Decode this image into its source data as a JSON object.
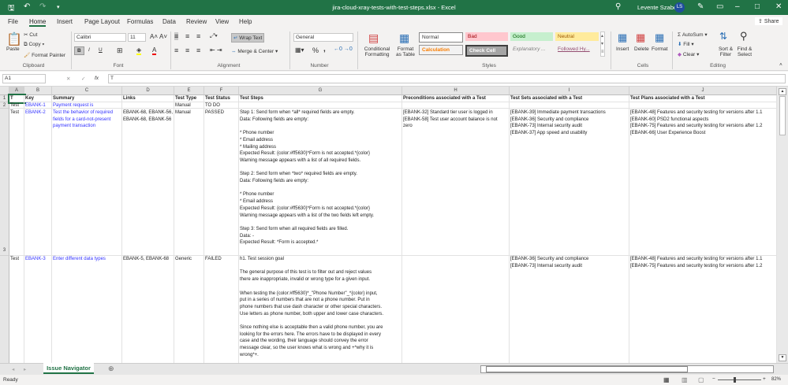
{
  "title": "jira-cloud-xray-tests-with-test-steps.xlsx - Excel",
  "user": {
    "name": "Levente Szabo",
    "initials": "LS"
  },
  "share": "Share",
  "tabs": [
    "File",
    "Home",
    "Insert",
    "Page Layout",
    "Formulas",
    "Data",
    "Review",
    "View",
    "Help"
  ],
  "ribbon": {
    "clipboard": {
      "paste": "Paste",
      "cut": "Cut",
      "copy": "Copy",
      "format_painter": "Format Painter",
      "label": "Clipboard"
    },
    "font": {
      "name": "Calibri",
      "size": "11",
      "bold": "B",
      "italic": "I",
      "underline": "U",
      "label": "Font"
    },
    "alignment": {
      "wrap": "Wrap Text",
      "merge": "Merge & Center",
      "label": "Alignment"
    },
    "number": {
      "format": "General",
      "percent": "%",
      "comma": ",",
      "label": "Number"
    },
    "styles": {
      "conditional": "Conditional Formatting",
      "format_table": "Format as Table",
      "normal": "Normal",
      "bad": "Bad",
      "good": "Good",
      "neutral": "Neutral",
      "calculation": "Calculation",
      "check": "Check Cell",
      "explanatory": "Explanatory ...",
      "followed": "Followed Hy...",
      "label": "Styles"
    },
    "cells": {
      "insert": "Insert",
      "delete": "Delete",
      "format": "Format",
      "label": "Cells"
    },
    "editing": {
      "autosum": "AutoSum",
      "fill": "Fill",
      "clear": "Clear",
      "sort": "Sort & Filter",
      "find": "Find & Select",
      "label": "Editing"
    }
  },
  "formula_bar": {
    "name_box": "A1",
    "cancel": "✕",
    "enter": "✓",
    "fx": "fx",
    "value": "T"
  },
  "columns": [
    "A",
    "B",
    "C",
    "D",
    "E",
    "F",
    "G",
    "H",
    "I",
    "J"
  ],
  "row_numbers": [
    "1",
    "2",
    "3"
  ],
  "headers": [
    "T",
    "Key",
    "Summary",
    "Links",
    "Test Type",
    "Test Status",
    "Test Steps",
    "Preconditions associated with a Test",
    "Test Sets associated with a Test",
    "Test Plans associated with a Test"
  ],
  "rows": [
    [
      "Test",
      "EBANK-1",
      "Payment request is",
      "",
      "Manual",
      "TO DO",
      "",
      "",
      "",
      ""
    ],
    [
      "Test",
      "EBANK-2",
      "Test the behavior of required\nfields for a card-not-present\npayment transaction",
      "EBANK-68, EBANK-56,\nEBANK-68, EBANK-56",
      "Manual",
      "PASSED",
      "Step 1: Send form when *all* required fields are empty.\nData: Following fields are empty:\n\n* Phone number\n* Email address\n* Mailing address\nExpected Result: {color:#ff5630}*Form is not accepted.*{color}\nWarning message appears with a list of all required fields.\n\nStep 2: Send form when *two* required fields are empty.\nData: Following fields are empty:\n\n* Phone number\n* Email address\nExpected Result: {color:#ff5630}*Form is not accepted.*{color}\nWarning message appears with a list of the two fields left empty.\n\nStep 3: Send form when all required fields are filled.\nData: -\nExpected Result: *Form is accepted.*",
      "[EBANK-32] Standard tier user is logged in\n[EBANK-58] Test user account balance is not\nzero",
      "[EBANK-39] Immediate payment transactions\n[EBANK-36] Security and compliance\n[EBANK-73] Internal security audit\n[EBANK-37] App speed and usability",
      "[EBANK-48] Features and security testing for versions after 1.1\n[EBANK-60] PSD2 functional aspects\n[EBANK-75] Features and security testing for versions after 1.2\n[EBANK-66] User Experience Boost"
    ],
    [
      "Test",
      "EBANK-3",
      "Enter different data types",
      "EBANK-5, EBANK-68",
      "Generic",
      "FAILED",
      "h1. Test session goal\n\nThe general purpose of this test is to filter out and reject values\nthere are inappropriate, invalid or wrong type for a given input.\n\nWhen testing the {color:#ff5630}*_\"Phone Number\"_*{color} input,\nput in a series of numbers that are not a phone number. Put in\nphone numbers that use dash character or other special characters.\nUse letters as phone number, both upper and lower case characters.\n\nSince nothing else is acceptable then a valid phone number, you are\nlooking for the errors here. The errors have to be displayed in every\ncase and the wording, their language should convey the error\nmessage clear, so the user knows what is wrong and +*why it is\nwrong*+.",
      "",
      "[EBANK-36] Security and compliance\n[EBANK-73] Internal security audit",
      "[EBANK-48] Features and security testing for versions after 1.1\n[EBANK-75] Features and security testing for versions after 1.2"
    ]
  ],
  "sheet_tab": "Issue Navigator",
  "status": {
    "ready": "Ready",
    "zoom": "82%"
  }
}
